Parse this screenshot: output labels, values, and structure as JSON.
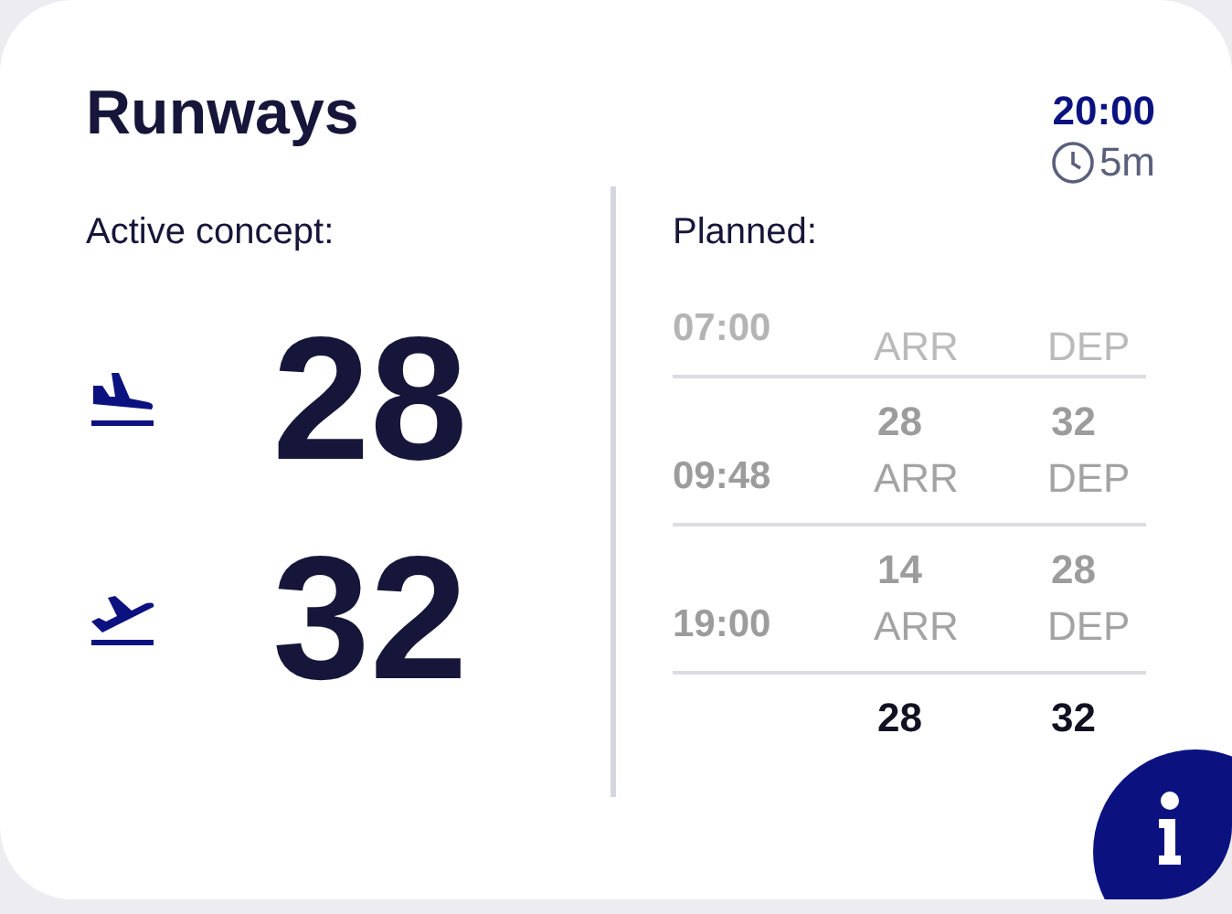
{
  "card": {
    "title": "Runways",
    "time": "20:00",
    "interval": "5m"
  },
  "active": {
    "label": "Active concept:",
    "runways": [
      {
        "kind": "arrival",
        "number": "28"
      },
      {
        "kind": "departure",
        "number": "32"
      }
    ]
  },
  "planned": {
    "label": "Planned:",
    "rows": [
      {
        "time": "07:00",
        "arr_label": "ARR",
        "dep_label": "DEP",
        "faded": true,
        "selected": false
      },
      {
        "time": "09:48",
        "arr": "28",
        "dep": "32",
        "arr_label": "ARR",
        "dep_label": "DEP",
        "faded": false,
        "selected": false
      },
      {
        "time": "19:00",
        "arr": "14",
        "dep": "28",
        "arr_label": "ARR",
        "dep_label": "DEP",
        "faded": false,
        "selected": false
      },
      {
        "arr": "28",
        "dep": "32",
        "faded": false,
        "selected": true
      }
    ]
  }
}
